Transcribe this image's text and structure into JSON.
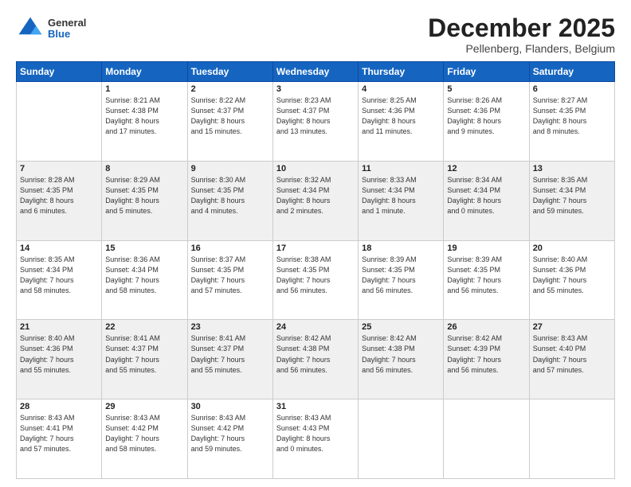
{
  "logo": {
    "general": "General",
    "blue": "Blue"
  },
  "title": "December 2025",
  "subtitle": "Pellenberg, Flanders, Belgium",
  "days_of_week": [
    "Sunday",
    "Monday",
    "Tuesday",
    "Wednesday",
    "Thursday",
    "Friday",
    "Saturday"
  ],
  "weeks": [
    [
      {
        "day": "",
        "info": ""
      },
      {
        "day": "1",
        "info": "Sunrise: 8:21 AM\nSunset: 4:38 PM\nDaylight: 8 hours\nand 17 minutes."
      },
      {
        "day": "2",
        "info": "Sunrise: 8:22 AM\nSunset: 4:37 PM\nDaylight: 8 hours\nand 15 minutes."
      },
      {
        "day": "3",
        "info": "Sunrise: 8:23 AM\nSunset: 4:37 PM\nDaylight: 8 hours\nand 13 minutes."
      },
      {
        "day": "4",
        "info": "Sunrise: 8:25 AM\nSunset: 4:36 PM\nDaylight: 8 hours\nand 11 minutes."
      },
      {
        "day": "5",
        "info": "Sunrise: 8:26 AM\nSunset: 4:36 PM\nDaylight: 8 hours\nand 9 minutes."
      },
      {
        "day": "6",
        "info": "Sunrise: 8:27 AM\nSunset: 4:35 PM\nDaylight: 8 hours\nand 8 minutes."
      }
    ],
    [
      {
        "day": "7",
        "info": "Sunrise: 8:28 AM\nSunset: 4:35 PM\nDaylight: 8 hours\nand 6 minutes."
      },
      {
        "day": "8",
        "info": "Sunrise: 8:29 AM\nSunset: 4:35 PM\nDaylight: 8 hours\nand 5 minutes."
      },
      {
        "day": "9",
        "info": "Sunrise: 8:30 AM\nSunset: 4:35 PM\nDaylight: 8 hours\nand 4 minutes."
      },
      {
        "day": "10",
        "info": "Sunrise: 8:32 AM\nSunset: 4:34 PM\nDaylight: 8 hours\nand 2 minutes."
      },
      {
        "day": "11",
        "info": "Sunrise: 8:33 AM\nSunset: 4:34 PM\nDaylight: 8 hours\nand 1 minute."
      },
      {
        "day": "12",
        "info": "Sunrise: 8:34 AM\nSunset: 4:34 PM\nDaylight: 8 hours\nand 0 minutes."
      },
      {
        "day": "13",
        "info": "Sunrise: 8:35 AM\nSunset: 4:34 PM\nDaylight: 7 hours\nand 59 minutes."
      }
    ],
    [
      {
        "day": "14",
        "info": "Sunrise: 8:35 AM\nSunset: 4:34 PM\nDaylight: 7 hours\nand 58 minutes."
      },
      {
        "day": "15",
        "info": "Sunrise: 8:36 AM\nSunset: 4:34 PM\nDaylight: 7 hours\nand 58 minutes."
      },
      {
        "day": "16",
        "info": "Sunrise: 8:37 AM\nSunset: 4:35 PM\nDaylight: 7 hours\nand 57 minutes."
      },
      {
        "day": "17",
        "info": "Sunrise: 8:38 AM\nSunset: 4:35 PM\nDaylight: 7 hours\nand 56 minutes."
      },
      {
        "day": "18",
        "info": "Sunrise: 8:39 AM\nSunset: 4:35 PM\nDaylight: 7 hours\nand 56 minutes."
      },
      {
        "day": "19",
        "info": "Sunrise: 8:39 AM\nSunset: 4:35 PM\nDaylight: 7 hours\nand 56 minutes."
      },
      {
        "day": "20",
        "info": "Sunrise: 8:40 AM\nSunset: 4:36 PM\nDaylight: 7 hours\nand 55 minutes."
      }
    ],
    [
      {
        "day": "21",
        "info": "Sunrise: 8:40 AM\nSunset: 4:36 PM\nDaylight: 7 hours\nand 55 minutes."
      },
      {
        "day": "22",
        "info": "Sunrise: 8:41 AM\nSunset: 4:37 PM\nDaylight: 7 hours\nand 55 minutes."
      },
      {
        "day": "23",
        "info": "Sunrise: 8:41 AM\nSunset: 4:37 PM\nDaylight: 7 hours\nand 55 minutes."
      },
      {
        "day": "24",
        "info": "Sunrise: 8:42 AM\nSunset: 4:38 PM\nDaylight: 7 hours\nand 56 minutes."
      },
      {
        "day": "25",
        "info": "Sunrise: 8:42 AM\nSunset: 4:38 PM\nDaylight: 7 hours\nand 56 minutes."
      },
      {
        "day": "26",
        "info": "Sunrise: 8:42 AM\nSunset: 4:39 PM\nDaylight: 7 hours\nand 56 minutes."
      },
      {
        "day": "27",
        "info": "Sunrise: 8:43 AM\nSunset: 4:40 PM\nDaylight: 7 hours\nand 57 minutes."
      }
    ],
    [
      {
        "day": "28",
        "info": "Sunrise: 8:43 AM\nSunset: 4:41 PM\nDaylight: 7 hours\nand 57 minutes."
      },
      {
        "day": "29",
        "info": "Sunrise: 8:43 AM\nSunset: 4:42 PM\nDaylight: 7 hours\nand 58 minutes."
      },
      {
        "day": "30",
        "info": "Sunrise: 8:43 AM\nSunset: 4:42 PM\nDaylight: 7 hours\nand 59 minutes."
      },
      {
        "day": "31",
        "info": "Sunrise: 8:43 AM\nSunset: 4:43 PM\nDaylight: 8 hours\nand 0 minutes."
      },
      {
        "day": "",
        "info": ""
      },
      {
        "day": "",
        "info": ""
      },
      {
        "day": "",
        "info": ""
      }
    ]
  ]
}
